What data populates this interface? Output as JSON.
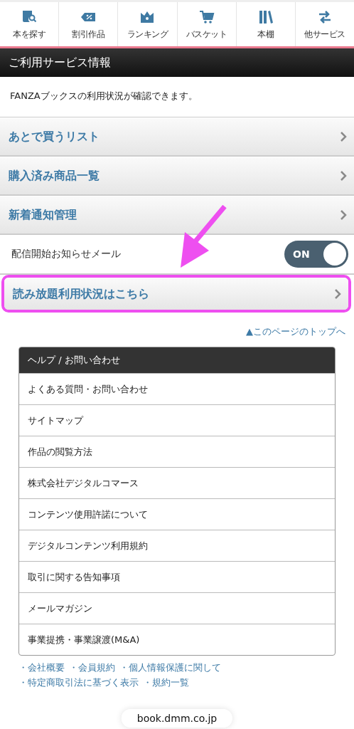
{
  "nav": [
    {
      "label": "本を探す",
      "kind": "search"
    },
    {
      "label": "割引作品",
      "kind": "sale"
    },
    {
      "label": "ランキング",
      "kind": "ranking"
    },
    {
      "label": "バスケット",
      "kind": "basket"
    },
    {
      "label": "本棚",
      "kind": "bookshelf"
    },
    {
      "label": "他サービス",
      "kind": "services"
    }
  ],
  "section_title": "ご利用サービス情報",
  "description": "FANZAブックスの利用状況が確認できます。",
  "menu": [
    {
      "kind": "link",
      "label": "あとで買うリスト",
      "highlighted": false
    },
    {
      "kind": "link",
      "label": "購入済み商品一覧",
      "highlighted": false
    },
    {
      "kind": "link",
      "label": "新着通知管理",
      "highlighted": false
    },
    {
      "kind": "toggle",
      "label": "配信開始お知らせメール",
      "on": true,
      "state_label": "ON"
    },
    {
      "kind": "link",
      "label": "読み放題利用状況はこちら",
      "highlighted": true
    }
  ],
  "page_top_link": "▲このページのトップへ",
  "help": {
    "title": "ヘルプ / お問い合わせ",
    "items": [
      "よくある質問・お問い合わせ",
      "サイトマップ",
      "作品の閲覧方法",
      "株式会社デジタルコマース",
      "コンテンツ使用許諾について",
      "デジタルコンテンツ利用規約",
      "取引に関する告知事項",
      "メールマガジン",
      "事業提携・事業譲渡(M&A)"
    ]
  },
  "footer_links": [
    [
      "・会社概要",
      "・会員規約",
      "・個人情報保護に関して"
    ],
    [
      "・特定商取引法に基づく表示",
      "・規約一覧"
    ]
  ],
  "address_bar": "book.dmm.co.jp"
}
